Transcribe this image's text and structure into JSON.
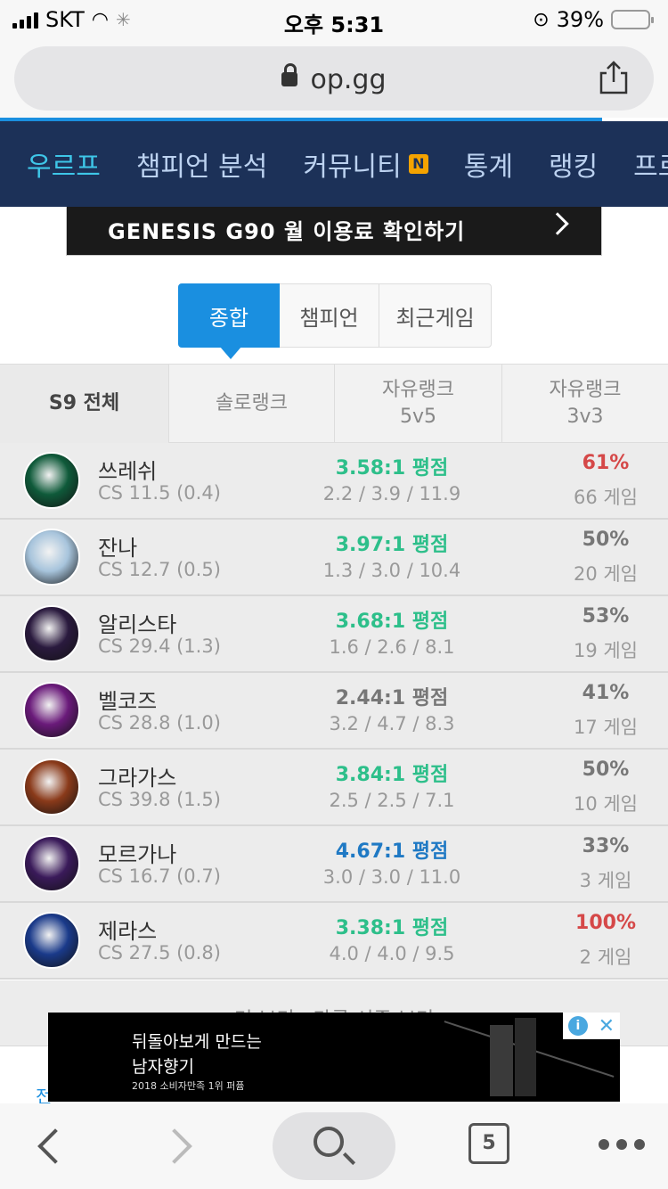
{
  "status": {
    "carrier": "SKT",
    "time": "오후 5:31",
    "battery": "39%",
    "battery_level": 0.39
  },
  "browser": {
    "url": "op.gg",
    "tab_count": "5"
  },
  "nav": {
    "items": [
      "우르프",
      "챔피언 분석",
      "커뮤니티",
      "통계",
      "랭킹",
      "프로관"
    ],
    "badge": "N"
  },
  "ad_top": {
    "text": "GENESIS G90 월 이용료 확인하기"
  },
  "tabs": [
    "종합",
    "챔피언",
    "최근게임"
  ],
  "season_tabs": [
    {
      "line1": "S9 전체",
      "line2": ""
    },
    {
      "line1": "솔로랭크",
      "line2": ""
    },
    {
      "line1": "자유랭크",
      "line2": "5v5"
    },
    {
      "line1": "자유랭크",
      "line2": "3v3"
    }
  ],
  "champions": [
    {
      "name": "쓰레쉬",
      "cs": "CS 11.5 (0.4)",
      "kda": "3.58:1 평점",
      "kda_detail": "2.2 / 3.9 / 11.9",
      "winrate": "61%",
      "games": "66 게임",
      "kda_color": "#2dbf8a",
      "wr_color": "#d54848"
    },
    {
      "name": "잔나",
      "cs": "CS 12.7 (0.5)",
      "kda": "3.97:1 평점",
      "kda_detail": "1.3 / 3.0 / 10.4",
      "winrate": "50%",
      "games": "20 게임",
      "kda_color": "#2dbf8a",
      "wr_color": "#777777"
    },
    {
      "name": "알리스타",
      "cs": "CS 29.4 (1.3)",
      "kda": "3.68:1 평점",
      "kda_detail": "1.6 / 2.6 / 8.1",
      "winrate": "53%",
      "games": "19 게임",
      "kda_color": "#2dbf8a",
      "wr_color": "#777777"
    },
    {
      "name": "벨코즈",
      "cs": "CS 28.8 (1.0)",
      "kda": "2.44:1 평점",
      "kda_detail": "3.2 / 4.7 / 8.3",
      "winrate": "41%",
      "games": "17 게임",
      "kda_color": "#777777",
      "wr_color": "#777777"
    },
    {
      "name": "그라가스",
      "cs": "CS 39.8 (1.5)",
      "kda": "3.84:1 평점",
      "kda_detail": "2.5 / 2.5 / 7.1",
      "winrate": "50%",
      "games": "10 게임",
      "kda_color": "#2dbf8a",
      "wr_color": "#777777"
    },
    {
      "name": "모르가나",
      "cs": "CS 16.7 (0.7)",
      "kda": "4.67:1 평점",
      "kda_detail": "3.0 / 3.0 / 11.0",
      "winrate": "33%",
      "games": "3 게임",
      "kda_color": "#1f79c4",
      "wr_color": "#777777"
    },
    {
      "name": "제라스",
      "cs": "CS 27.5 (0.8)",
      "kda": "3.38:1 평점",
      "kda_detail": "4.0 / 4.0 / 9.5",
      "winrate": "100%",
      "games": "2 게임",
      "kda_color": "#2dbf8a",
      "wr_color": "#d54848"
    }
  ],
  "avatar_colors": [
    "#0f5a3a",
    "#a7c4dc",
    "#2a1a3e",
    "#6a1a7a",
    "#8a3a1a",
    "#3a1a5a",
    "#1a3a8a"
  ],
  "more_text": "더 보기 · 다른 시즌 보기",
  "ad_bottom": {
    "line1": "뒤돌아보게 만드는",
    "line2": "남자향기",
    "line3": "2018 소비자만족 1위 퍼퓸"
  },
  "bottom_link": "전"
}
